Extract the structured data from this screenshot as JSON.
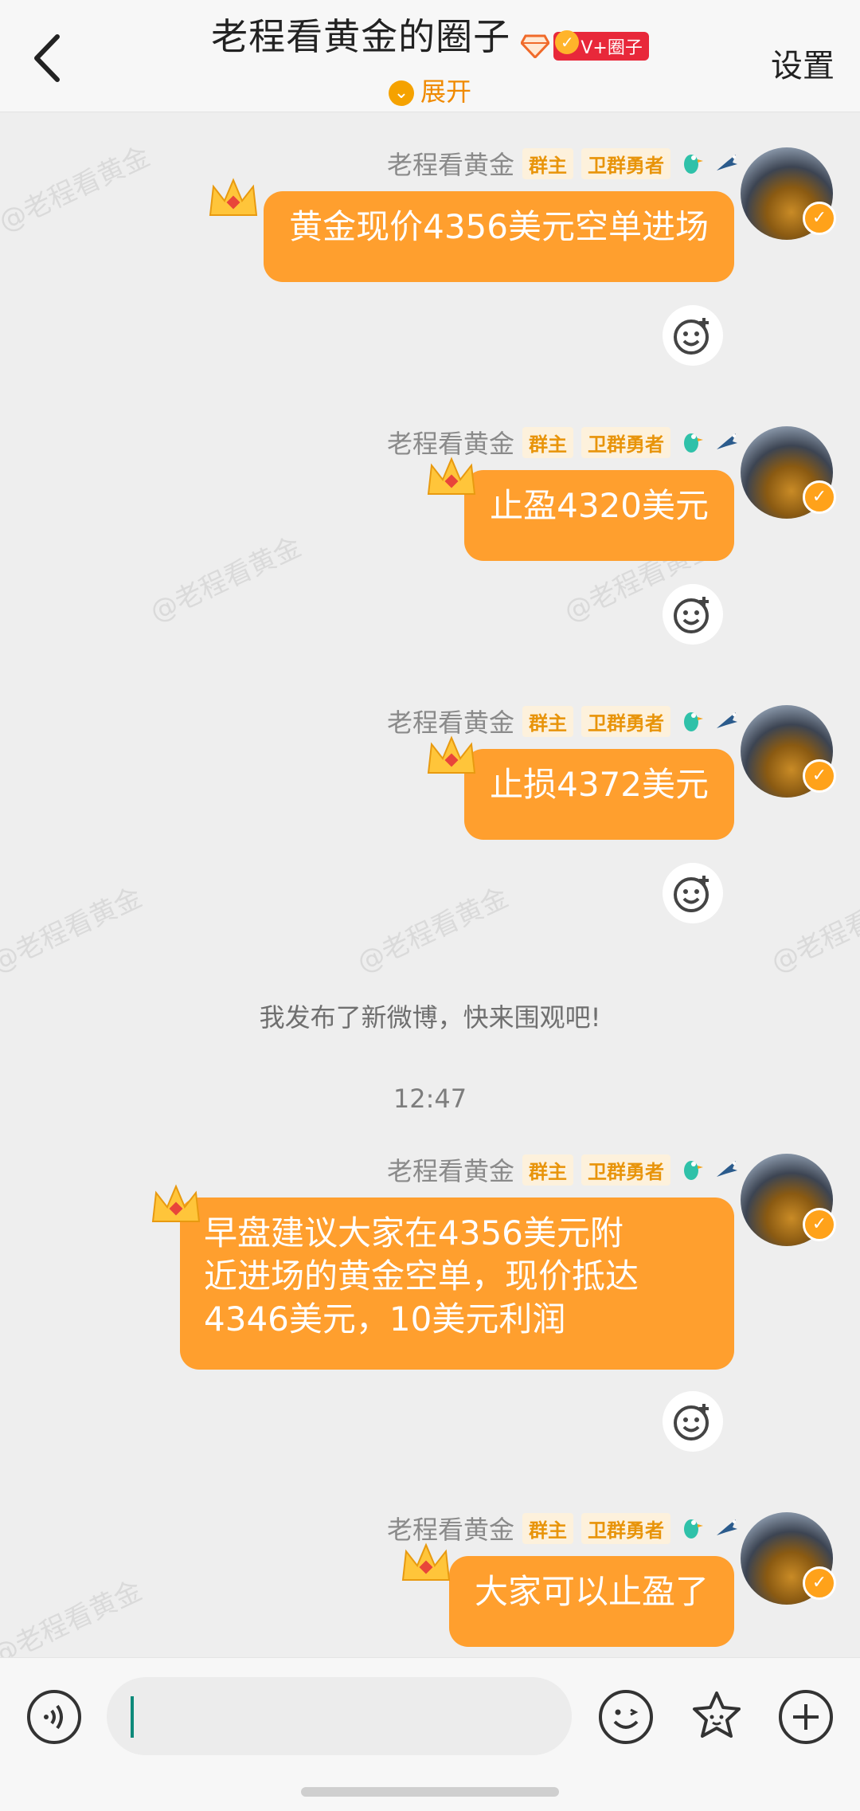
{
  "header": {
    "title": "老程看黄金的圈子",
    "badge_text": "V+圈子",
    "expand_label": "展开",
    "settings_label": "设置"
  },
  "messages": [
    {
      "sender": "老程看黄金",
      "tags": [
        "群主",
        "卫群勇者"
      ],
      "lines": [
        "黄金现价4356美元空单进场"
      ]
    },
    {
      "sender": "老程看黄金",
      "tags": [
        "群主",
        "卫群勇者"
      ],
      "lines": [
        "止盈4320美元"
      ]
    },
    {
      "sender": "老程看黄金",
      "tags": [
        "群主",
        "卫群勇者"
      ],
      "lines": [
        "止损4372美元"
      ]
    },
    {
      "sender": "老程看黄金",
      "tags": [
        "群主",
        "卫群勇者"
      ],
      "lines": [
        "早盘建议大家在4356美元附",
        "近进场的黄金空单，现价抵达",
        "4346美元，10美元利润"
      ]
    },
    {
      "sender": "老程看黄金",
      "tags": [
        "群主",
        "卫群勇者"
      ],
      "lines": [
        "大家可以止盈了"
      ]
    }
  ],
  "system_message": "我发布了新微博，快来围观吧!",
  "timestamp": "12:47",
  "watermark": "@老程看黄金",
  "colors": {
    "accent": "#ff9f2e",
    "tag_text": "#e8940a",
    "badge_red": "#e8283a"
  }
}
